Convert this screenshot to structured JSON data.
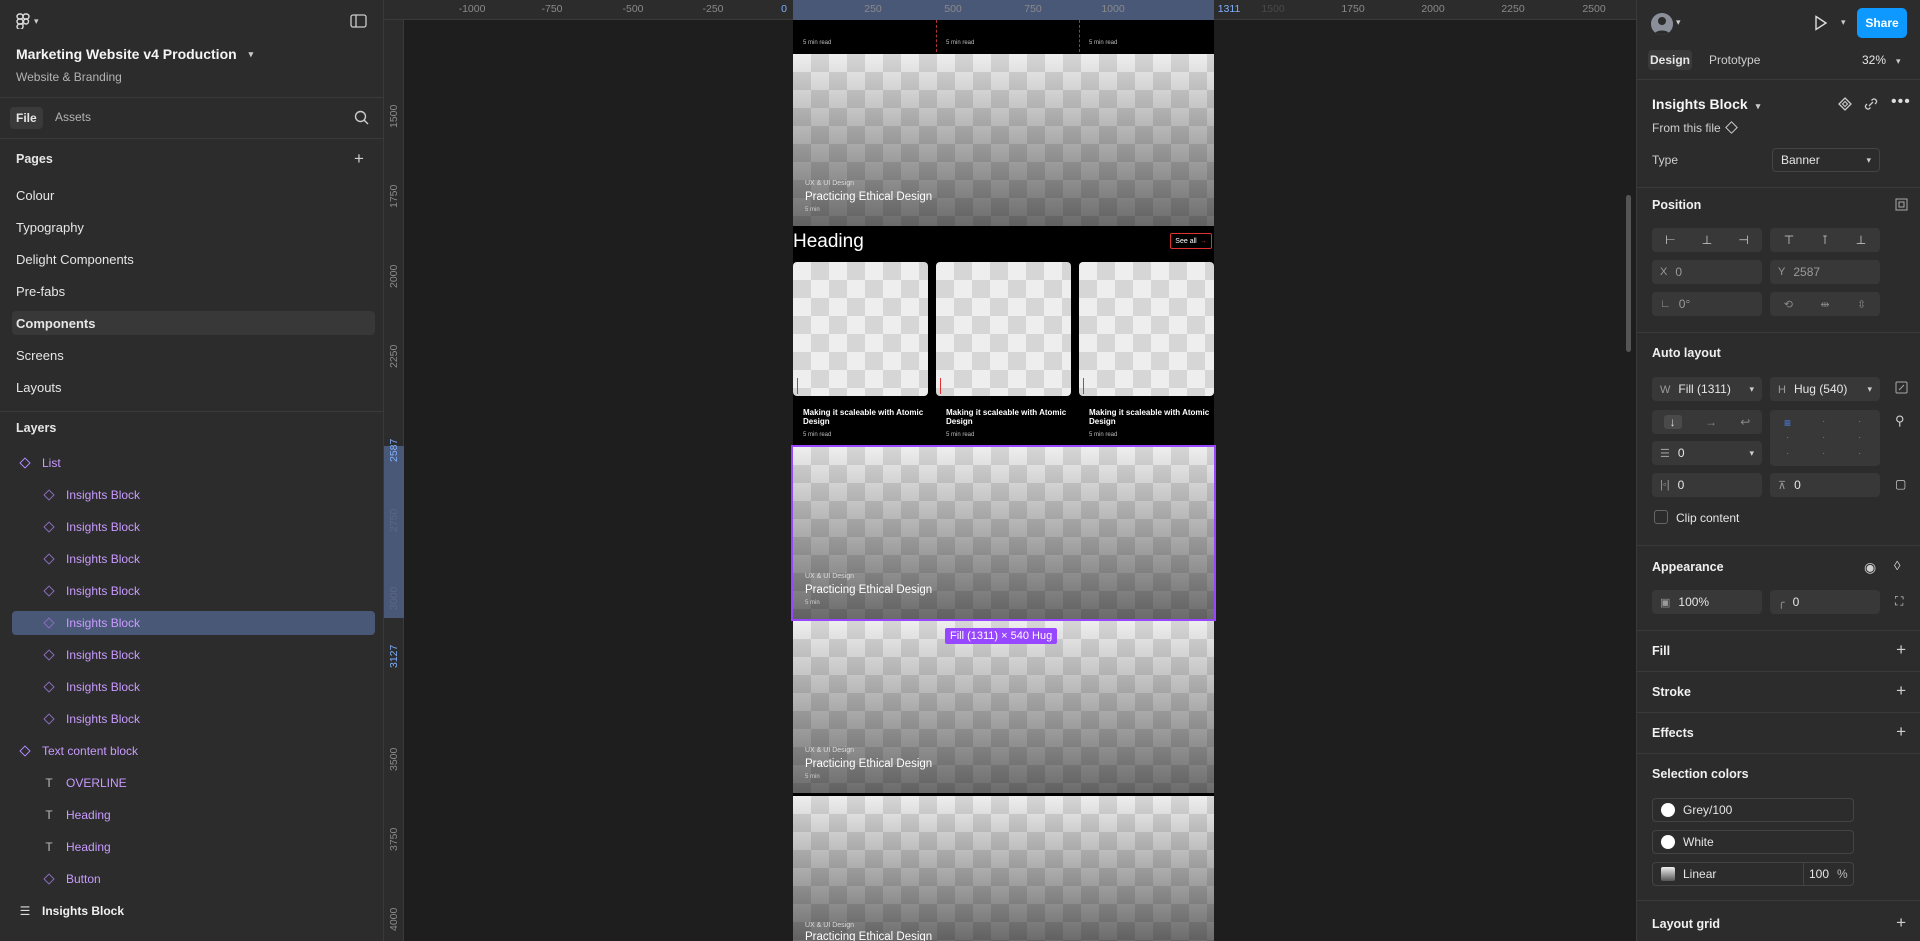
{
  "file": {
    "title": "Marketing Website v4 Production",
    "project": "Website & Branding"
  },
  "left_tabs": {
    "file": "File",
    "assets": "Assets"
  },
  "pages": {
    "header": "Pages",
    "items": [
      "Colour",
      "Typography",
      "Delight Components",
      "Pre-fabs",
      "Components",
      "Screens",
      "Layouts"
    ],
    "selected": "Components"
  },
  "layers": {
    "header": "Layers",
    "items": [
      {
        "label": "List",
        "type": "component",
        "indent": 0
      },
      {
        "label": "Insights Block",
        "type": "component",
        "indent": 1
      },
      {
        "label": "Insights Block",
        "type": "component",
        "indent": 1
      },
      {
        "label": "Insights Block",
        "type": "component",
        "indent": 1
      },
      {
        "label": "Insights Block",
        "type": "component",
        "indent": 1
      },
      {
        "label": "Insights Block",
        "type": "component",
        "indent": 1,
        "selected": true
      },
      {
        "label": "Insights Block",
        "type": "component",
        "indent": 1
      },
      {
        "label": "Insights Block",
        "type": "component",
        "indent": 1
      },
      {
        "label": "Insights Block",
        "type": "component",
        "indent": 1
      },
      {
        "label": "Text content block",
        "type": "component",
        "indent": 0
      },
      {
        "label": "OVERLINE",
        "type": "text",
        "indent": 1
      },
      {
        "label": "Heading",
        "type": "text",
        "indent": 1
      },
      {
        "label": "Heading",
        "type": "text",
        "indent": 1
      },
      {
        "label": "Button",
        "type": "component",
        "indent": 1
      },
      {
        "label": "Insights Block",
        "type": "frame",
        "indent": 0
      }
    ]
  },
  "rulers": {
    "top": [
      "-1000",
      "-750",
      "-500",
      "-250",
      "0",
      "250",
      "500",
      "750",
      "1000",
      "1311",
      "1500",
      "1750",
      "2000",
      "2250",
      "2500"
    ],
    "left": [
      "1500",
      "1750",
      "2000",
      "2250",
      "2587",
      "2750",
      "3000",
      "3127",
      "3500",
      "3750",
      "4000"
    ]
  },
  "canvas": {
    "heading": "Heading",
    "see_all": "See all",
    "banner_category": "UX & UI Design",
    "banner_title": "Practicing Ethical Design",
    "banner_min": "5 min",
    "card_title": "Making it scaleable with Atomic Design",
    "card_min": "5 min read",
    "size_badge": "Fill (1311) × 540 Hug"
  },
  "toolbar": {
    "design_tab": "Design",
    "prototype_tab": "Prototype",
    "zoom": "32%",
    "share": "Share"
  },
  "inspector": {
    "component_name": "Insights Block",
    "source": "From this file",
    "type_label": "Type",
    "type_value": "Banner",
    "position_header": "Position",
    "x_label": "X",
    "x_value": "0",
    "y_label": "Y",
    "y_value": "2587",
    "rotation": "0°",
    "auto_layout_header": "Auto layout",
    "w_label": "W",
    "w_value": "Fill (1311)",
    "h_label": "H",
    "h_value": "Hug (540)",
    "gap": "0",
    "pad_h": "0",
    "pad_v": "0",
    "clip_content": "Clip content",
    "appearance_header": "Appearance",
    "opacity": "100%",
    "radius": "0",
    "fill_header": "Fill",
    "stroke_header": "Stroke",
    "effects_header": "Effects",
    "selection_colors_header": "Selection colors",
    "colors": [
      {
        "name": "Grey/100"
      },
      {
        "name": "White"
      },
      {
        "name": "Linear",
        "opacity": "100",
        "unit": "%"
      }
    ],
    "layout_grid_header": "Layout grid"
  },
  "colors": {
    "accent": "#0d99ff",
    "selection": "#9747ff",
    "component": "#c99bff"
  }
}
